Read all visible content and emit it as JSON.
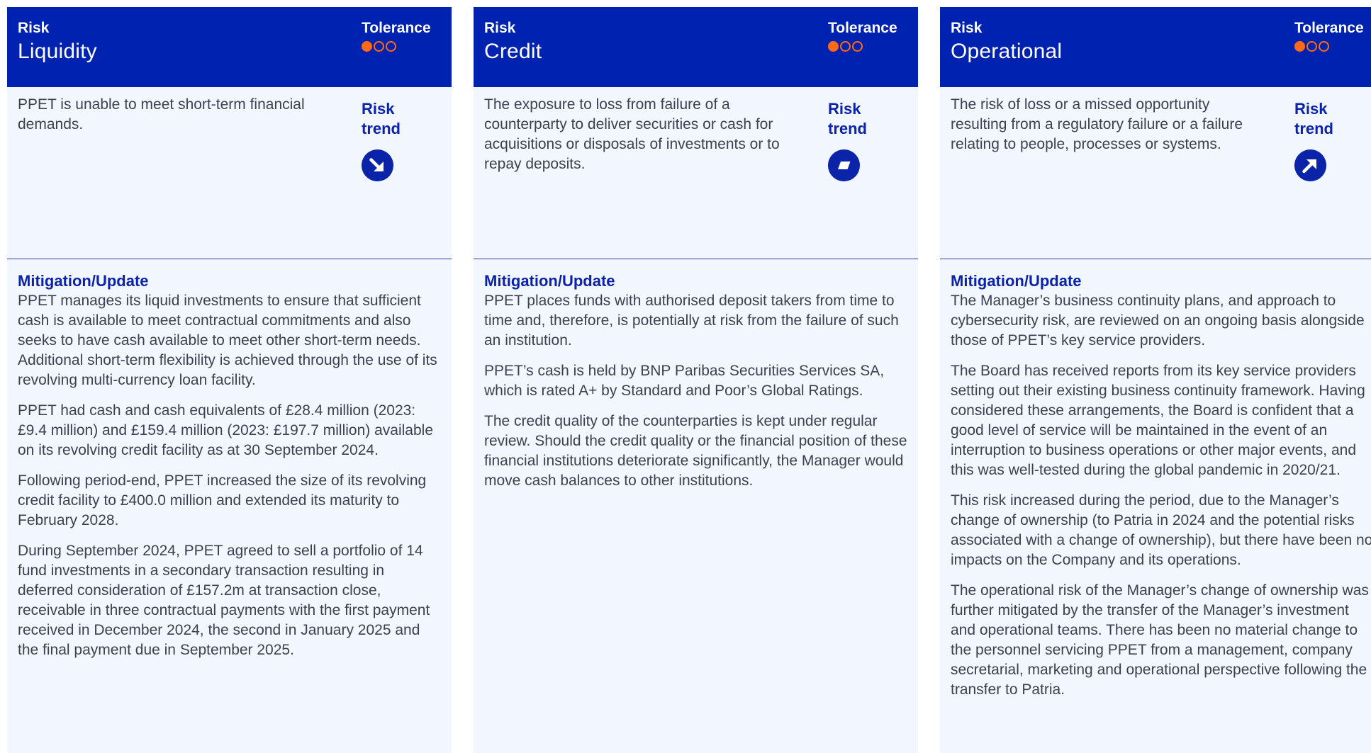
{
  "colors": {
    "header_bg": "#0022b0",
    "accent_orange": "#ff6a14",
    "card_bg": "#f2f6ff",
    "trend_blue": "#0a23a8"
  },
  "cards": [
    {
      "risk_label": "Risk",
      "title": "Liquidity",
      "tolerance_label": "Tolerance",
      "tolerance_level": 1,
      "description": "PPET is unable to meet short-term financial demands.",
      "trend_label": "Risk\ntrend",
      "trend_icon": "arrow-down-right-icon",
      "mitigation_heading": "Mitigation/Update",
      "paragraphs": [
        "PPET manages its liquid investments to ensure that sufficient cash is available to meet contractual commitments and also seeks to have cash available to meet other short-term needs. Additional short-term flexibility is achieved through the use of its revolving multi-currency loan facility.",
        "PPET had cash and cash equivalents of £28.4 million (2023: £9.4 million) and £159.4 million (2023: £197.7 million) available on its revolving credit facility as at 30 September 2024.",
        "Following period-end, PPET increased the size of its revolving credit facility to £400.0 million and extended its maturity to February 2028.",
        "During September 2024, PPET agreed to sell a portfolio of 14 fund investments in a secondary transaction resulting in deferred consideration of £157.2m at transaction close, receivable in three contractual payments with the first payment received in December 2024, the second in January 2025 and the final payment due in September 2025."
      ]
    },
    {
      "risk_label": "Risk",
      "title": "Credit",
      "tolerance_label": "Tolerance",
      "tolerance_level": 1,
      "description": "The exposure to loss from failure of a counterparty to deliver securities or cash for acquisitions or disposals of investments or to repay deposits.",
      "trend_label": "Risk\ntrend",
      "trend_icon": "stable-trend-icon",
      "mitigation_heading": "Mitigation/Update",
      "paragraphs": [
        "PPET places funds with authorised deposit takers from time to time and, therefore, is potentially at risk from the failure of such an institution.",
        "PPET’s cash is held by BNP Paribas Securities Services SA, which is rated A+ by Standard and Poor’s Global Ratings.",
        "The credit quality of the counterparties is kept under regular review. Should the credit quality or the financial position of these financial institutions deteriorate significantly, the Manager would move cash balances to other institutions."
      ]
    },
    {
      "risk_label": "Risk",
      "title": "Operational",
      "tolerance_label": "Tolerance",
      "tolerance_level": 1,
      "description": "The risk of loss or a missed opportunity resulting from a regulatory failure or a failure relating to people, processes or systems.",
      "trend_label": "Risk\ntrend",
      "trend_icon": "arrow-up-right-icon",
      "mitigation_heading": "Mitigation/Update",
      "paragraphs": [
        "The Manager’s business continuity plans, and approach to cybersecurity risk, are reviewed on an ongoing basis alongside those of PPET’s key service providers.",
        "The Board has received reports from its key service providers setting out their existing business continuity framework. Having considered these arrangements, the Board is confident that a good level of service will be maintained in the event of an interruption to business operations or other major events, and this was well-tested during the global pandemic in 2020/21.",
        "This risk increased during the period, due to the Manager’s change of ownership (to Patria in 2024 and the potential risks associated with a change of ownership), but there have been no impacts on the Company and its operations.",
        "The operational risk of the Manager’s change of ownership was further mitigated by the transfer of the Manager’s investment and operational teams. There has been no material change to the personnel servicing PPET from a management, company secretarial, marketing and operational perspective following the transfer to Patria."
      ]
    }
  ]
}
